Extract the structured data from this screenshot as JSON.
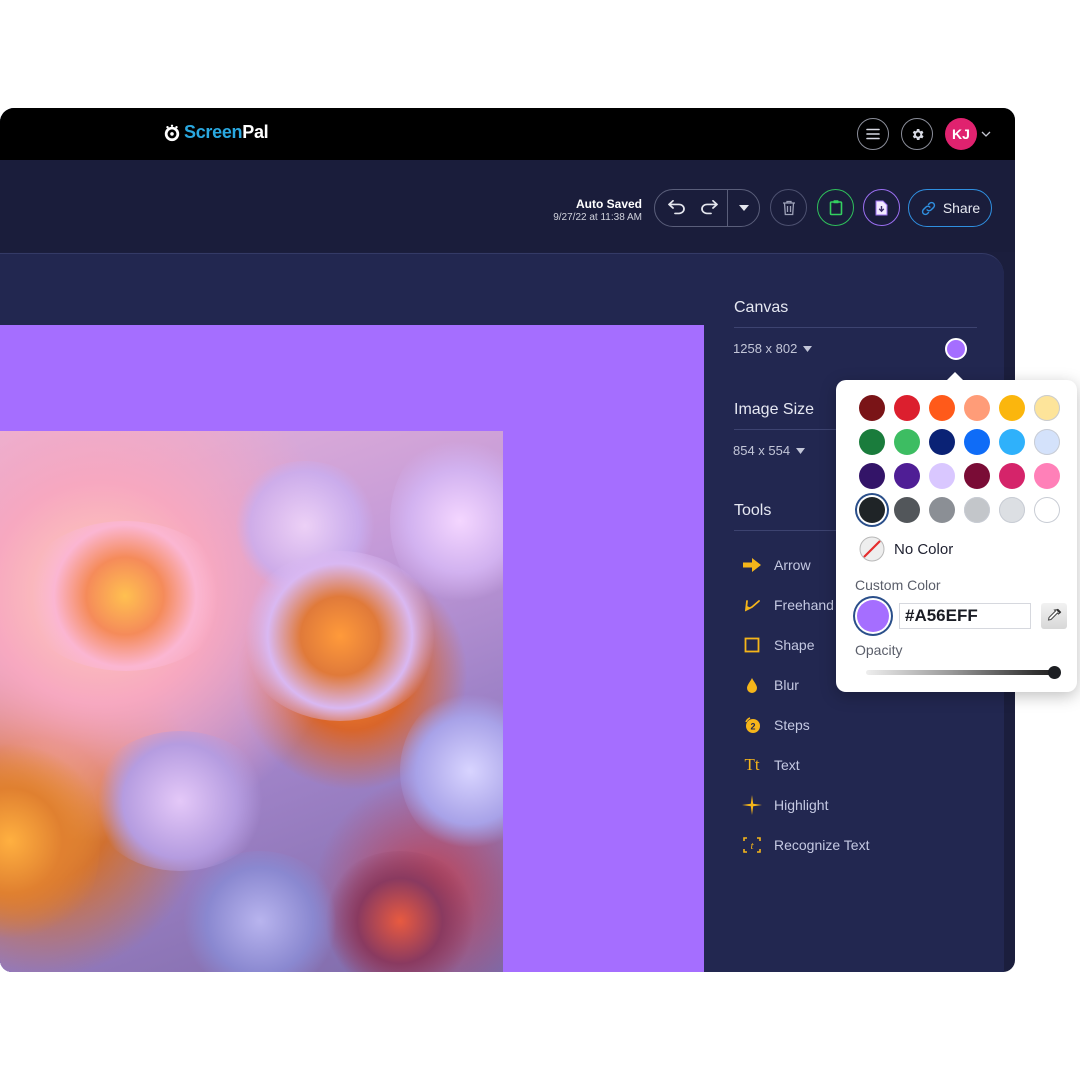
{
  "app": {
    "logo_screen": "Screen",
    "logo_pal": "Pal"
  },
  "topbar": {
    "menu_icon": "hamburger-menu-icon",
    "settings_icon": "gear-icon",
    "avatar_initials": "KJ",
    "avatar_color": "#e0226f"
  },
  "toolbar": {
    "autosave_title": "Auto Saved",
    "autosave_time": "9/27/22 at 11:38 AM",
    "undo_icon": "undo-icon",
    "redo_icon": "redo-icon",
    "history_dropdown_icon": "caret-down-icon",
    "delete_icon": "trash-icon",
    "copy_icon": "clipboard-icon",
    "download_icon": "download-file-icon",
    "share_label": "Share"
  },
  "sidebar": {
    "canvas_title": "Canvas",
    "canvas_size": "1258 x 802",
    "canvas_color": "#A56EFF",
    "image_size_title": "Image Size",
    "image_size": "854 x 554",
    "tools_title": "Tools",
    "tools": [
      {
        "label": "Arrow",
        "icon": "arrow-right-icon"
      },
      {
        "label": "Freehand",
        "icon": "freehand-pen-icon"
      },
      {
        "label": "Shape",
        "icon": "square-shape-icon"
      },
      {
        "label": "Blur",
        "icon": "droplet-icon"
      },
      {
        "label": "Steps",
        "icon": "steps-badge-icon",
        "badge": "2"
      },
      {
        "label": "Text",
        "icon": "text-tt-icon",
        "glyph": "Tt"
      },
      {
        "label": "Highlight",
        "icon": "sparkle-icon"
      },
      {
        "label": "Recognize Text",
        "icon": "recognize-text-icon",
        "glyph": "t"
      }
    ]
  },
  "color_picker": {
    "swatches": [
      "#7a1417",
      "#dc1f2e",
      "#ff5a1a",
      "#ff9c78",
      "#fbb60d",
      "#fde49a",
      "#1a7c3c",
      "#3dbd62",
      "#0a2275",
      "#0f6cf7",
      "#2fb1fb",
      "#d4e2fb",
      "#331468",
      "#4f1e95",
      "#d9c7ff",
      "#7a0c36",
      "#d5246a",
      "#ff80b8",
      "#1f2427",
      "#52565a",
      "#8b8f95",
      "#c3c6ca",
      "#dcdfe3",
      "#ffffff"
    ],
    "selected_index": 18,
    "no_color_label": "No Color",
    "custom_color_label": "Custom Color",
    "custom_color_value": "#A56EFF",
    "eyedropper_icon": "eyedropper-icon",
    "opacity_label": "Opacity",
    "opacity_value": 1.0
  }
}
